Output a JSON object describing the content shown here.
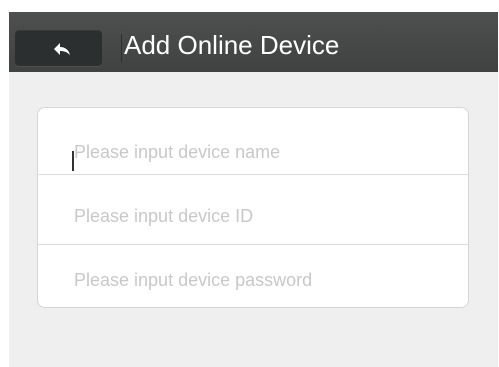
{
  "header": {
    "title": "Add Online Device",
    "back_icon": "back-arrow-icon"
  },
  "form": {
    "device_name_placeholder": "Please input device name",
    "device_id_placeholder": "Please input device ID",
    "device_password_placeholder": "Please input device password"
  },
  "colors": {
    "header_background": "#454847",
    "back_button_background": "#2c2f2f",
    "page_background": "#efefef",
    "placeholder_text": "#c8c8c8"
  }
}
